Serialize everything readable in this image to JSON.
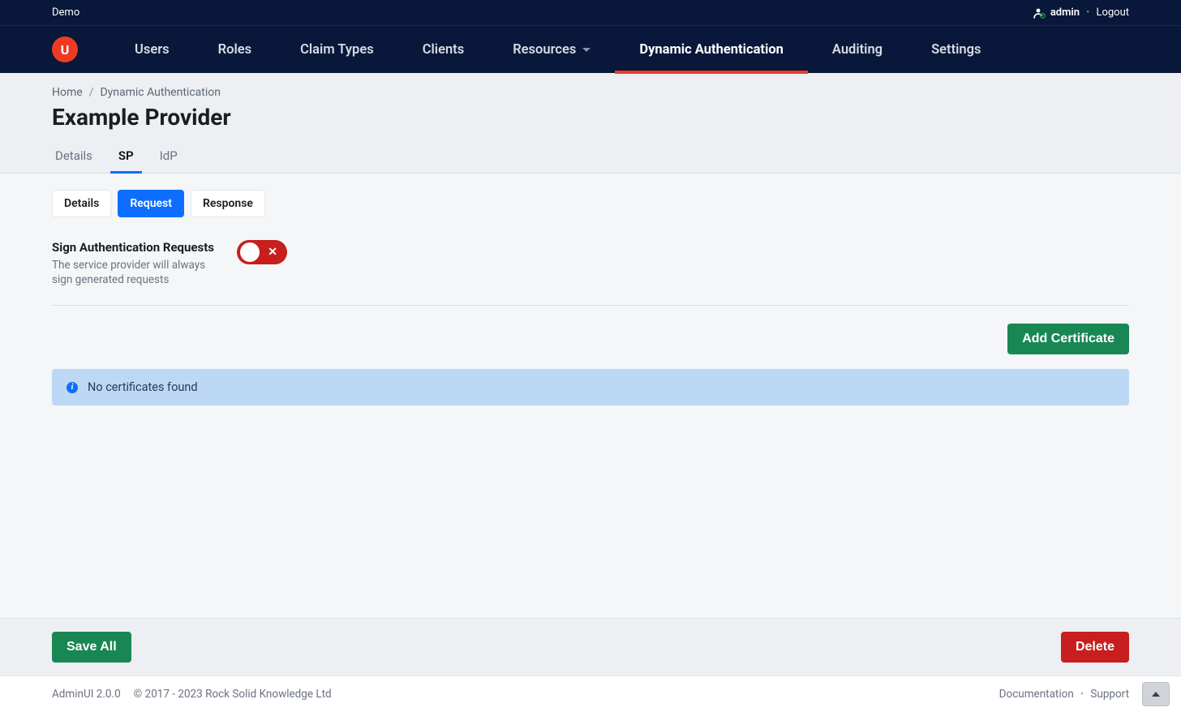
{
  "topbar": {
    "tenant": "Demo",
    "username": "admin",
    "logout": "Logout"
  },
  "nav": {
    "items": [
      "Users",
      "Roles",
      "Claim Types",
      "Clients",
      "Resources",
      "Dynamic Authentication",
      "Auditing",
      "Settings"
    ],
    "active_index": 5,
    "dropdown_indices": [
      4
    ]
  },
  "breadcrumb": {
    "home": "Home",
    "current": "Dynamic Authentication"
  },
  "page": {
    "title": "Example Provider",
    "tabs": [
      "Details",
      "SP",
      "IdP"
    ],
    "active_tab_index": 1
  },
  "sp": {
    "pill_tabs": [
      "Details",
      "Request",
      "Response"
    ],
    "active_pill_index": 1,
    "toggle": {
      "title": "Sign Authentication Requests",
      "desc": "The service provider will always sign generated requests"
    },
    "add_cert_label": "Add Certificate",
    "no_certs_msg": "No certificates found"
  },
  "actions": {
    "save": "Save All",
    "delete": "Delete"
  },
  "footer": {
    "product": "AdminUI 2.0.0",
    "copyright": "© 2017 - 2023 Rock Solid Knowledge Ltd",
    "doc": "Documentation",
    "support": "Support"
  }
}
